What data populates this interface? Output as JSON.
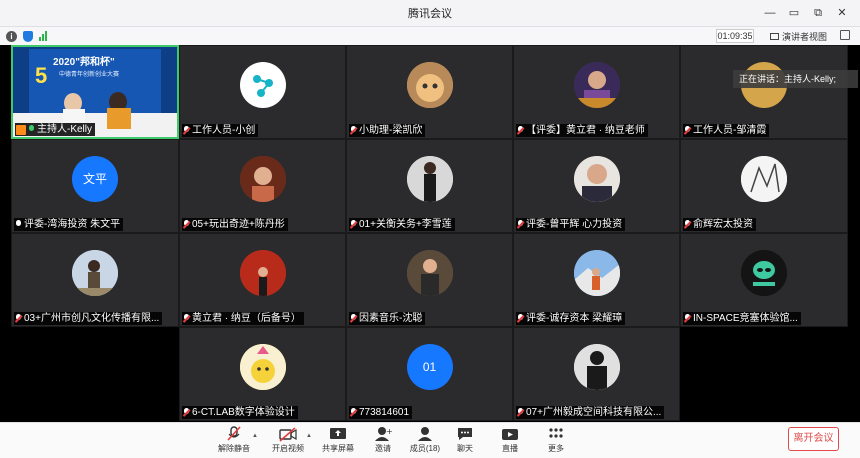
{
  "window": {
    "title": "腾讯会议",
    "controls": [
      "—",
      "▭",
      "⧉",
      "✕"
    ]
  },
  "infobar": {
    "timer": "01:09:35",
    "speaker_view_label": "演讲者视图"
  },
  "speaking_now": "正在讲话：主持人-Kelly;",
  "participants": [
    {
      "name": "主持人-Kelly",
      "avatar_text": "",
      "avatar_color": "#0f4c8a",
      "mic": "active",
      "host": true
    },
    {
      "name": "工作人员-小创",
      "avatar_text": "",
      "avatar_color": "#ffffff",
      "mic": "muted"
    },
    {
      "name": "小助理-梁凯欣",
      "avatar_text": "",
      "avatar_color": "#e8a25c",
      "mic": "muted"
    },
    {
      "name": "【评委】黄立君 · 纳豆老师",
      "avatar_text": "",
      "avatar_color": "#5a3a6a",
      "mic": "muted"
    },
    {
      "name": "工作人员-邹清霞",
      "avatar_text": "",
      "avatar_color": "#d4a54a",
      "mic": "muted"
    },
    {
      "name": "评委-湾海投资 朱文平",
      "avatar_text": "文平",
      "avatar_color": "#1677ff",
      "mic": "on"
    },
    {
      "name": "05+玩出奇迹+陈丹彤",
      "avatar_text": "",
      "avatar_color": "#8a3a2a",
      "mic": "muted"
    },
    {
      "name": "01+关衡关务+李雪莲",
      "avatar_text": "",
      "avatar_color": "#cfcfcf",
      "mic": "muted"
    },
    {
      "name": "评委-曾平辉 心力投资",
      "avatar_text": "",
      "avatar_color": "#c9a68a",
      "mic": "muted"
    },
    {
      "name": "俞辉宏太投资",
      "avatar_text": "",
      "avatar_color": "#f2f2f2",
      "mic": "muted"
    },
    {
      "name": "03+广州市创凡文化传播有限...",
      "avatar_text": "",
      "avatar_color": "#b9c6d6",
      "mic": "muted"
    },
    {
      "name": "黄立君 · 纳豆（后备号）",
      "avatar_text": "",
      "avatar_color": "#c23a2a",
      "mic": "muted"
    },
    {
      "name": "因素音乐-沈聪",
      "avatar_text": "",
      "avatar_color": "#7a6a5a",
      "mic": "muted"
    },
    {
      "name": "评委-诚存资本 梁耀璋",
      "avatar_text": "",
      "avatar_color": "#6a9ad0",
      "mic": "muted"
    },
    {
      "name": "IN-SPACE竞塞体验馆...",
      "avatar_text": "",
      "avatar_color": "#1a1a1a",
      "mic": "muted"
    },
    {
      "name": "6-CT.LAB数字体验设计",
      "avatar_text": "",
      "avatar_color": "#f6e27a",
      "mic": "muted"
    },
    {
      "name": "773814601",
      "avatar_text": "01",
      "avatar_color": "#1677ff",
      "mic": "muted"
    },
    {
      "name": "07+广州毅成空间科技有限公...",
      "avatar_text": "",
      "avatar_color": "#dcdcdc",
      "mic": "muted"
    }
  ],
  "toolbar": {
    "unmute": "解除静音",
    "video": "开启视频",
    "share": "共享屏幕",
    "invite": "邀请",
    "members": "成员(18)",
    "chat": "聊天",
    "live": "直播",
    "more": "更多",
    "leave": "离开会议"
  },
  "colors": {
    "active_border": "#3ec96a",
    "accent_blue": "#1677ff",
    "leave_red": "#e24b4b"
  }
}
